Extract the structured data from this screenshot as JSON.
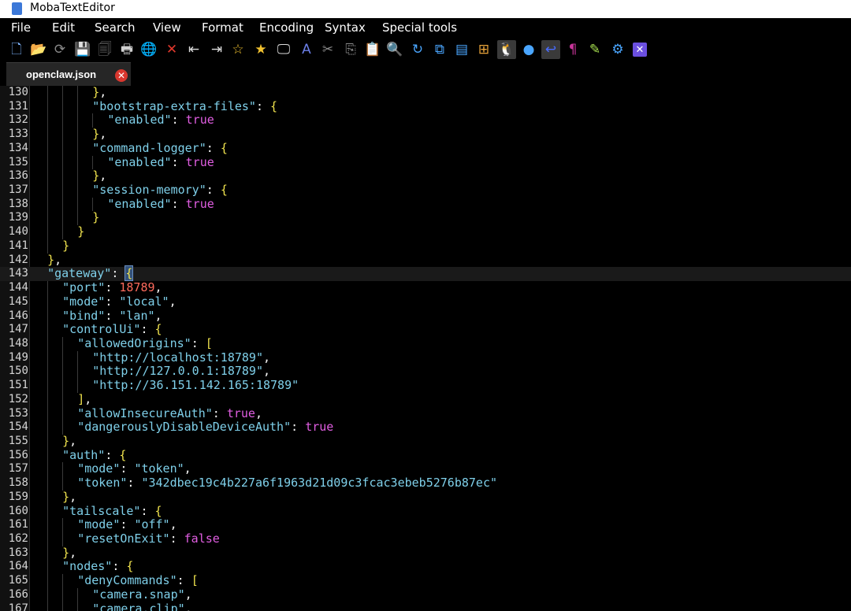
{
  "window": {
    "title": "MobaTextEditor"
  },
  "menu": [
    "File",
    "Edit",
    "Search",
    "View",
    "Format",
    "Encoding",
    "Syntax",
    "Special tools"
  ],
  "toolbar": [
    {
      "name": "new-file-icon",
      "glyph": "🗋",
      "color": "#7fb6ff"
    },
    {
      "name": "open-folder-icon",
      "glyph": "📂",
      "color": "#f2b330"
    },
    {
      "name": "reload-icon",
      "glyph": "⟳",
      "color": "#8a8a8a"
    },
    {
      "name": "save-icon",
      "glyph": "💾",
      "color": "#777"
    },
    {
      "name": "save-all-icon",
      "glyph": "🗐",
      "color": "#777"
    },
    {
      "name": "print-icon",
      "glyph": "🖶",
      "color": "#cfcfcf"
    },
    {
      "name": "globe-icon",
      "glyph": "🌐",
      "color": "#3cb371"
    },
    {
      "name": "close-file-icon",
      "glyph": "✕",
      "color": "#e0382c"
    },
    {
      "name": "unindent-icon",
      "glyph": "⇤",
      "color": "#dcdcdc"
    },
    {
      "name": "indent-icon",
      "glyph": "⇥",
      "color": "#dcdcdc"
    },
    {
      "name": "bookmark-star-icon",
      "glyph": "☆",
      "color": "#f2c230"
    },
    {
      "name": "star-icon",
      "glyph": "★",
      "color": "#f2c230"
    },
    {
      "name": "monitor-icon",
      "glyph": "🖵",
      "color": "#dcdcdc"
    },
    {
      "name": "font-icon",
      "glyph": "A",
      "color": "#6b7fe8"
    },
    {
      "name": "cut-icon",
      "glyph": "✂",
      "color": "#8a8a8a"
    },
    {
      "name": "copy-icon",
      "glyph": "⎘",
      "color": "#8a8a8a"
    },
    {
      "name": "paste-icon",
      "glyph": "📋",
      "color": "#9ec8ff"
    },
    {
      "name": "search-icon",
      "glyph": "🔍",
      "color": "#8fc8ff"
    },
    {
      "name": "replace-icon",
      "glyph": "↻",
      "color": "#4aa6ff"
    },
    {
      "name": "compare-icon",
      "glyph": "⧉",
      "color": "#4aa6ff"
    },
    {
      "name": "split-view-icon",
      "glyph": "▤",
      "color": "#4aa6ff"
    },
    {
      "name": "windows-icon",
      "glyph": "⊞",
      "color": "#e8a33a"
    },
    {
      "name": "linux-icon",
      "glyph": "🐧",
      "color": "#ffffff"
    },
    {
      "name": "apple-icon",
      "glyph": "●",
      "color": "#4aa6ff"
    },
    {
      "name": "word-wrap-icon",
      "glyph": "↩",
      "color": "#4a6cff"
    },
    {
      "name": "pilcrow-icon",
      "glyph": "¶",
      "color": "#c8359a"
    },
    {
      "name": "highlighter-icon",
      "glyph": "✎",
      "color": "#a8e050"
    },
    {
      "name": "settings-gears-icon",
      "glyph": "⚙",
      "color": "#4aa6ff"
    },
    {
      "name": "close-app-icon",
      "glyph": "✕",
      "color": "#ffffff"
    }
  ],
  "tab": {
    "label": "openclaw.json"
  },
  "editor": {
    "current_line": 143,
    "lines": [
      {
        "n": "130",
        "c": "        },"
      },
      {
        "n": "131",
        "c": "        \"bootstrap-extra-files\": {"
      },
      {
        "n": "132",
        "c": "          \"enabled\": true"
      },
      {
        "n": "133",
        "c": "        },"
      },
      {
        "n": "134",
        "c": "        \"command-logger\": {"
      },
      {
        "n": "135",
        "c": "          \"enabled\": true"
      },
      {
        "n": "136",
        "c": "        },"
      },
      {
        "n": "137",
        "c": "        \"session-memory\": {"
      },
      {
        "n": "138",
        "c": "          \"enabled\": true"
      },
      {
        "n": "139",
        "c": "        }"
      },
      {
        "n": "140",
        "c": "      }"
      },
      {
        "n": "141",
        "c": "    }"
      },
      {
        "n": "142",
        "c": "  },"
      },
      {
        "n": "143",
        "c": "  \"gateway\": {"
      },
      {
        "n": "144",
        "c": "    \"port\": 18789,"
      },
      {
        "n": "145",
        "c": "    \"mode\": \"local\","
      },
      {
        "n": "146",
        "c": "    \"bind\": \"lan\","
      },
      {
        "n": "147",
        "c": "    \"controlUi\": {"
      },
      {
        "n": "148",
        "c": "      \"allowedOrigins\": ["
      },
      {
        "n": "149",
        "c": "        \"http://localhost:18789\","
      },
      {
        "n": "150",
        "c": "        \"http://127.0.0.1:18789\","
      },
      {
        "n": "151",
        "c": "        \"http://36.151.142.165:18789\""
      },
      {
        "n": "152",
        "c": "      ],"
      },
      {
        "n": "153",
        "c": "      \"allowInsecureAuth\": true,"
      },
      {
        "n": "154",
        "c": "      \"dangerouslyDisableDeviceAuth\": true"
      },
      {
        "n": "155",
        "c": "    },"
      },
      {
        "n": "156",
        "c": "    \"auth\": {"
      },
      {
        "n": "157",
        "c": "      \"mode\": \"token\","
      },
      {
        "n": "158",
        "c": "      \"token\": \"342dbec19c4b227a6f1963d21d09c3fcac3ebeb5276b87ec\""
      },
      {
        "n": "159",
        "c": "    },"
      },
      {
        "n": "160",
        "c": "    \"tailscale\": {"
      },
      {
        "n": "161",
        "c": "      \"mode\": \"off\","
      },
      {
        "n": "162",
        "c": "      \"resetOnExit\": false"
      },
      {
        "n": "163",
        "c": "    },"
      },
      {
        "n": "164",
        "c": "    \"nodes\": {"
      },
      {
        "n": "165",
        "c": "      \"denyCommands\": ["
      },
      {
        "n": "166",
        "c": "        \"camera.snap\","
      },
      {
        "n": "167",
        "c": "        \"camera.clip\","
      }
    ]
  },
  "colors": {
    "key": "#7fd0ea",
    "boolean": "#e15ee2",
    "number": "#ff6b5d",
    "punctuation": "#f0e34e",
    "close_tab": "#d9372e"
  }
}
